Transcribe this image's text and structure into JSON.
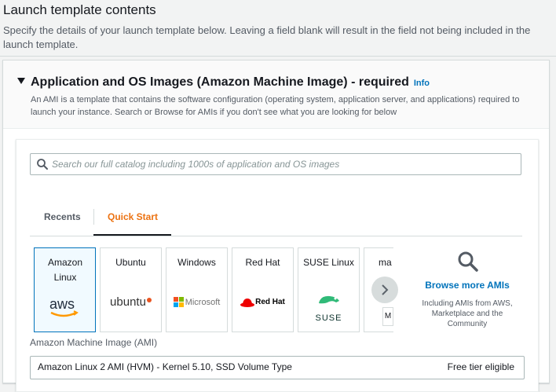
{
  "header": {
    "title": "Launch template contents",
    "description": "Specify the details of your launch template below. Leaving a field blank will result in the field not being included in the launch template."
  },
  "section": {
    "title": "Application and OS Images (Amazon Machine Image) - required",
    "info_label": "Info",
    "description": "An AMI is a template that contains the software configuration (operating system, application server, and applications) required to launch your instance. Search or Browse for AMIs if you don't see what you are looking for below"
  },
  "search": {
    "placeholder": "Search our full catalog including 1000s of application and OS images",
    "icon": "search-icon"
  },
  "tabs": [
    {
      "label": "Recents",
      "active": false
    },
    {
      "label": "Quick Start",
      "active": true
    }
  ],
  "os_tiles": [
    {
      "name": "Amazon Linux",
      "logo": "aws",
      "selected": true
    },
    {
      "name": "Ubuntu",
      "logo": "ubuntu",
      "selected": false
    },
    {
      "name": "Windows",
      "logo": "Microsoft",
      "selected": false
    },
    {
      "name": "Red Hat",
      "logo": "Red Hat",
      "selected": false
    },
    {
      "name": "SUSE Linux",
      "logo": "SUSE",
      "selected": false
    },
    {
      "name": "ma",
      "logo": "M",
      "selected": false
    }
  ],
  "browse": {
    "label": "Browse more AMIs",
    "description": "Including AMIs from AWS, Marketplace and the Community"
  },
  "ami": {
    "label": "Amazon Machine Image (AMI)",
    "selected_name": "Amazon Linux 2 AMI (HVM) - Kernel 5.10, SSD Volume Type",
    "badge": "Free tier eligible"
  },
  "colors": {
    "accent_orange": "#ec7211",
    "link_blue": "#0073bb",
    "selected_bg": "#f1faff"
  }
}
